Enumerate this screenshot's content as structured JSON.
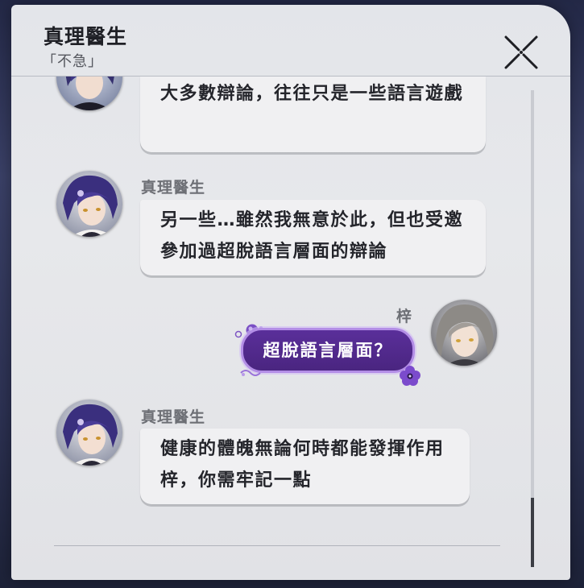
{
  "dialog": {
    "title": "真理醫生",
    "subtitle": "「不急」",
    "close_icon": "close-x-icon"
  },
  "messages": [
    {
      "sender": "",
      "side": "left",
      "text": "大多數辯論，往往只是一些語言遊戲",
      "avatar": "dr-ratio-avatar"
    },
    {
      "sender": "真理醫生",
      "side": "left",
      "text": "另一些…雖然我無意於此，但也受邀參加過超脫語言層面的辯論",
      "avatar": "dr-ratio-avatar"
    },
    {
      "sender": "梓",
      "side": "right",
      "text": "超脫語言層面？",
      "avatar": "trailblazer-avatar"
    },
    {
      "sender": "真理醫生",
      "side": "left",
      "text": "健康的體魄無論何時都能發揮作用梓，你需牢記一點",
      "avatar": "dr-ratio-avatar"
    }
  ],
  "colors": {
    "panel": "#e5e6ea",
    "player_bubble": "#4a2580",
    "player_bubble_border": "#b38ee6",
    "npc_bubble": "#f0f0f2"
  },
  "scroll_position": 0.95
}
